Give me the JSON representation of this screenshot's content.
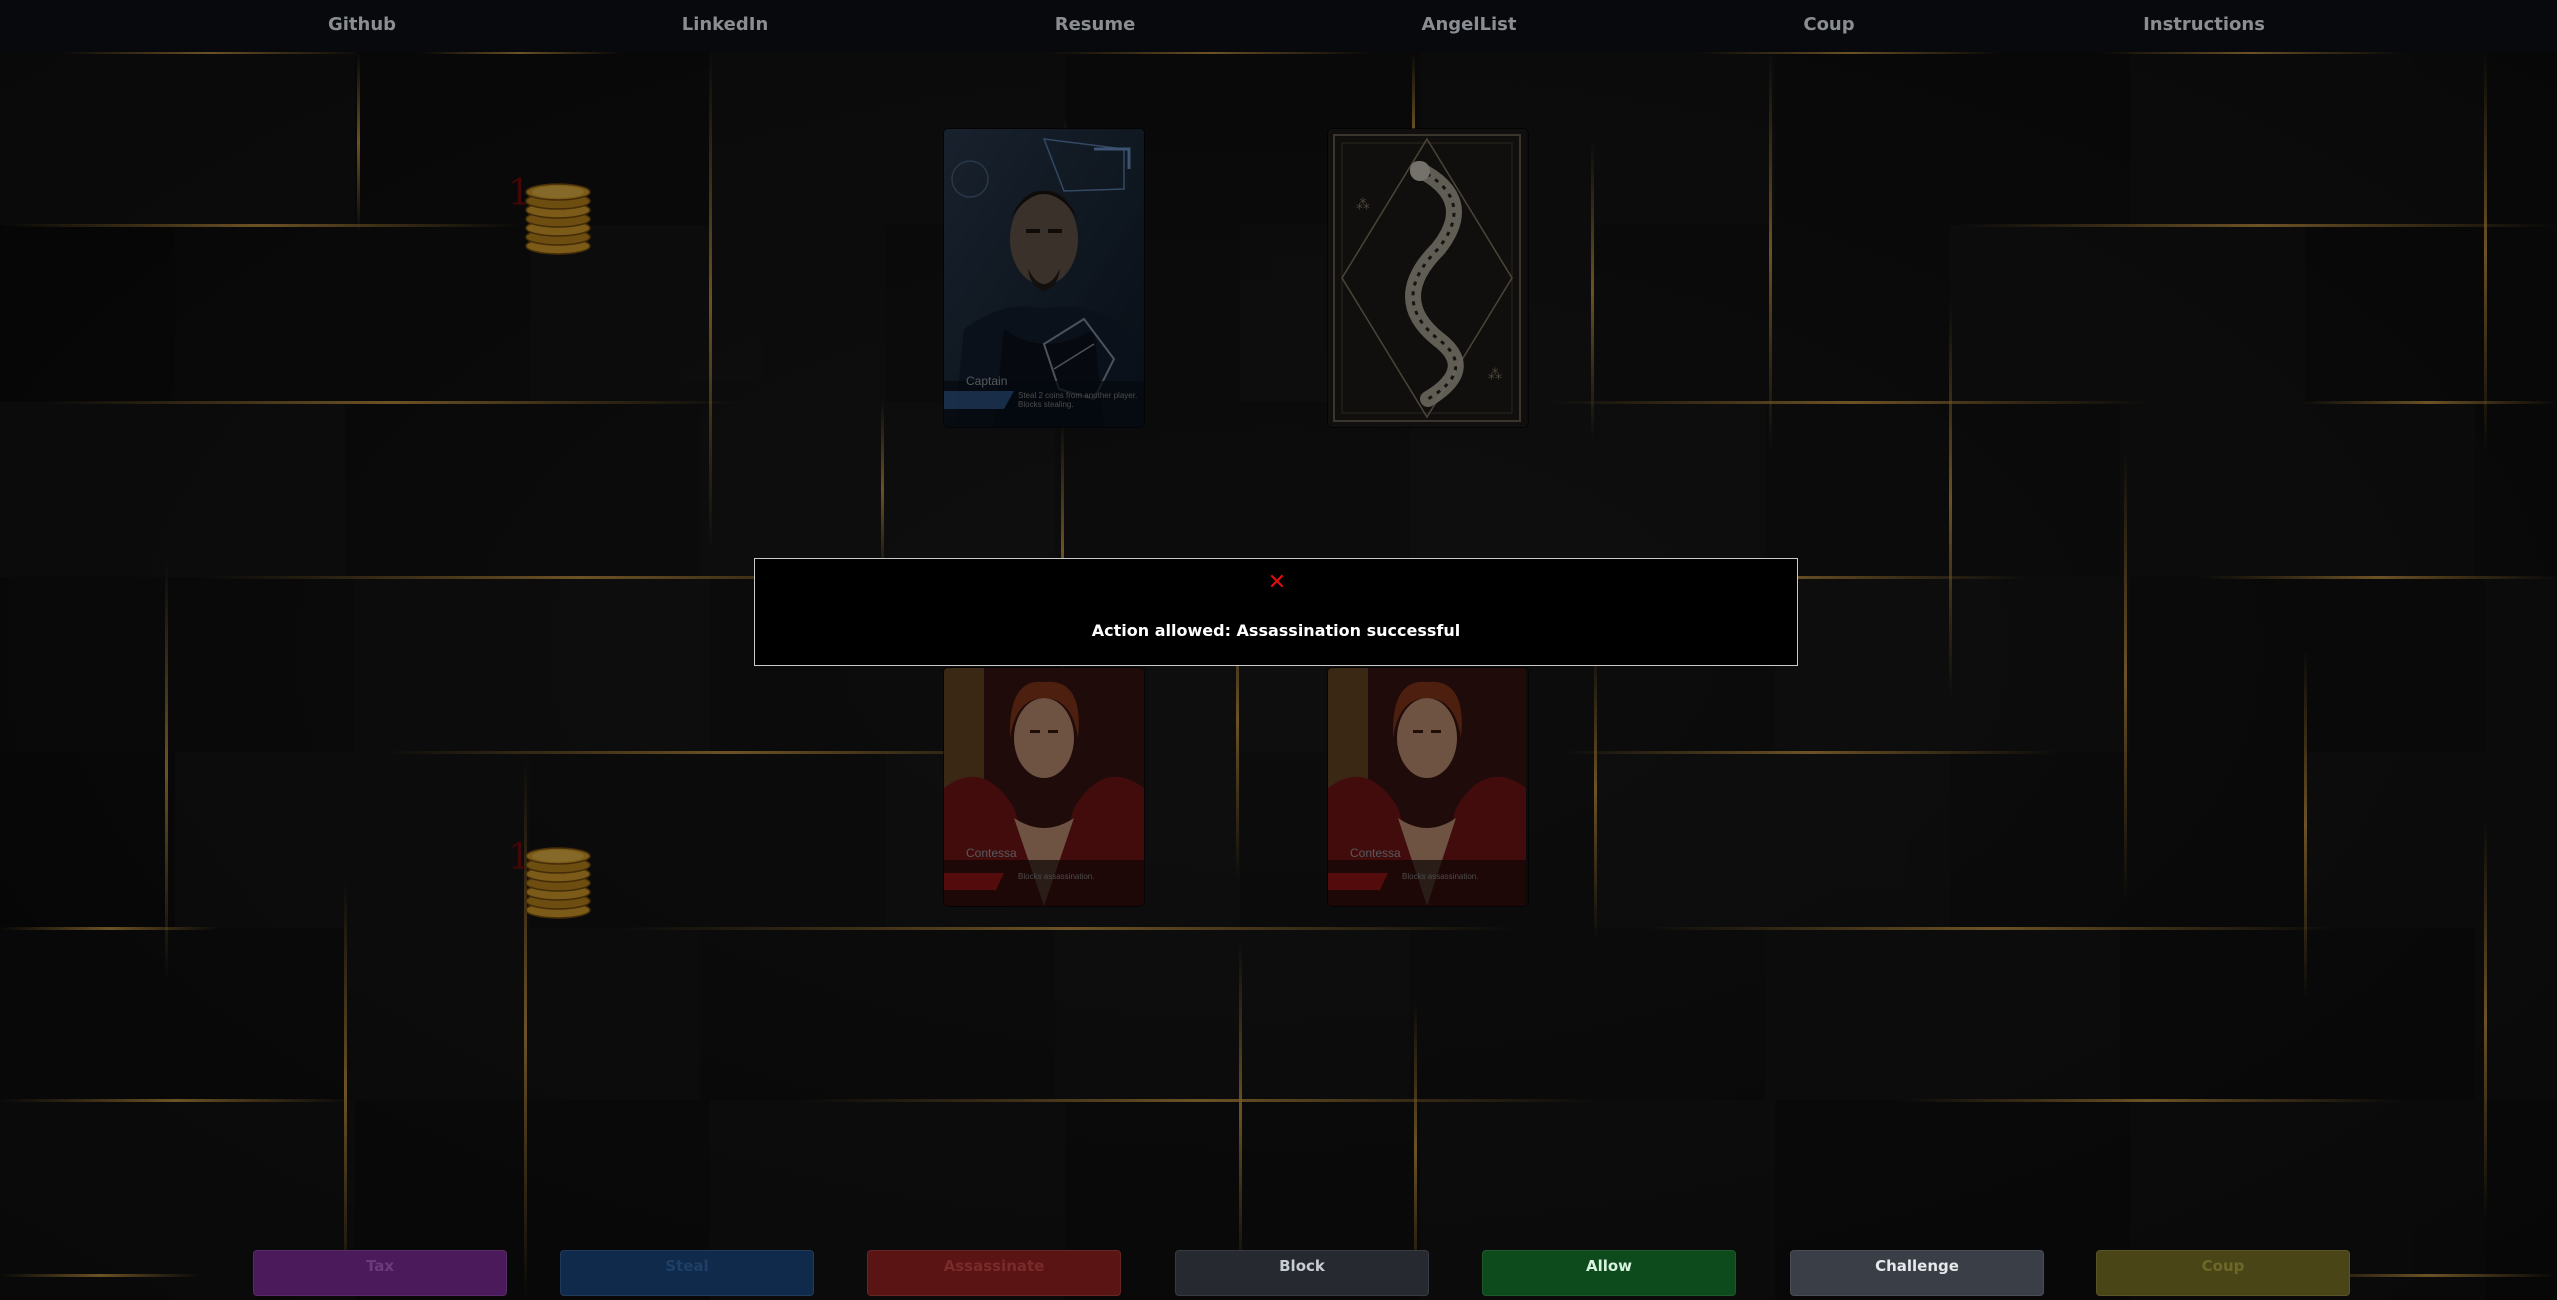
{
  "nav": {
    "items": [
      {
        "label": "Github"
      },
      {
        "label": "LinkedIn"
      },
      {
        "label": "Resume"
      },
      {
        "label": "AngelList"
      },
      {
        "label": "Coup"
      },
      {
        "label": "Instructions"
      }
    ]
  },
  "opponent": {
    "coins": "1",
    "cards": [
      {
        "name": "Captain",
        "description": "Steal 2 coins from another player. Blocks stealing.",
        "face": "up"
      },
      {
        "name": "",
        "description": "",
        "face": "down"
      }
    ]
  },
  "player": {
    "coins": "1",
    "cards": [
      {
        "name": "Contessa",
        "description": "Blocks assassination.",
        "face": "up"
      },
      {
        "name": "Contessa",
        "description": "Blocks assassination.",
        "face": "up"
      }
    ]
  },
  "modal": {
    "close_icon": "close-icon",
    "message": "Action allowed: Assassination successful"
  },
  "actions": [
    {
      "label": "Tax",
      "color": "#4a1a5a",
      "text_color": "#6b3a7a"
    },
    {
      "label": "Steal",
      "color": "#0f2a4a",
      "text_color": "#1f3f66"
    },
    {
      "label": "Assassinate",
      "color": "#5a1414",
      "text_color": "#7a2a2a"
    },
    {
      "label": "Block",
      "color": "#262a30",
      "text_color": "#c8cdd3"
    },
    {
      "label": "Allow",
      "color": "#0d4a1c",
      "text_color": "#d9f2de"
    },
    {
      "label": "Challenge",
      "color": "#3a3f47",
      "text_color": "#e6e8eb"
    },
    {
      "label": "Coup",
      "color": "#4a4516",
      "text_color": "#6e6828"
    }
  ]
}
